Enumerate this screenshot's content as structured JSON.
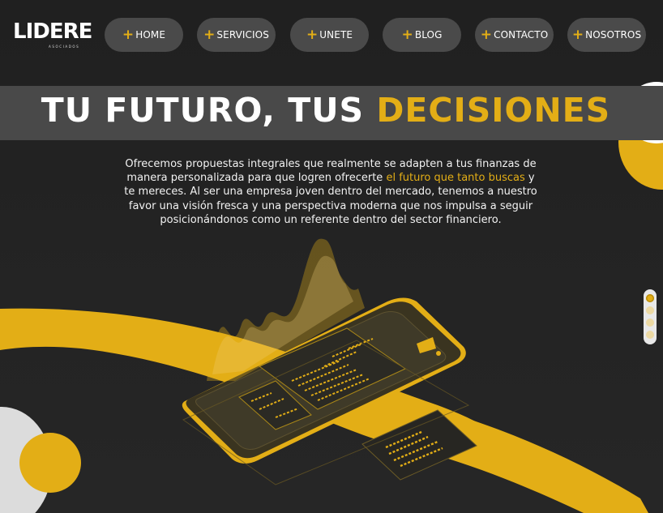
{
  "header": {
    "logo_text": "LIDERE",
    "logo_subtext": "ASOCIADOS",
    "nav": [
      {
        "label": "HOME"
      },
      {
        "label": "SERVICIOS"
      },
      {
        "label": "UNETE"
      },
      {
        "label": "BLOG"
      },
      {
        "label": "CONTACTO"
      },
      {
        "label": "NOSOTROS"
      }
    ],
    "nav_plus": "+"
  },
  "hero": {
    "headline_part1": "TU FUTURO, TUS ",
    "headline_part2": "DECISIONES",
    "intro_before": "Ofrecemos propuestas integrales que realmente se adapten a tus finanzas de manera personalizada para que logren ofrecerte ",
    "intro_accent": "el futuro que tanto buscas",
    "intro_after": " y te mereces. Al ser una empresa joven dentro del mercado, tenemos a nuestro favor una visión fresca y una perspectiva moderna que nos impulsa a seguir posicionándonos como un referente dentro del sector financiero."
  },
  "pager": {
    "total": 4,
    "active": 1
  },
  "colors": {
    "background": "#212121",
    "accent": "#e3ae16",
    "nav_button": "#4a4a4a",
    "banner": "#494949"
  }
}
